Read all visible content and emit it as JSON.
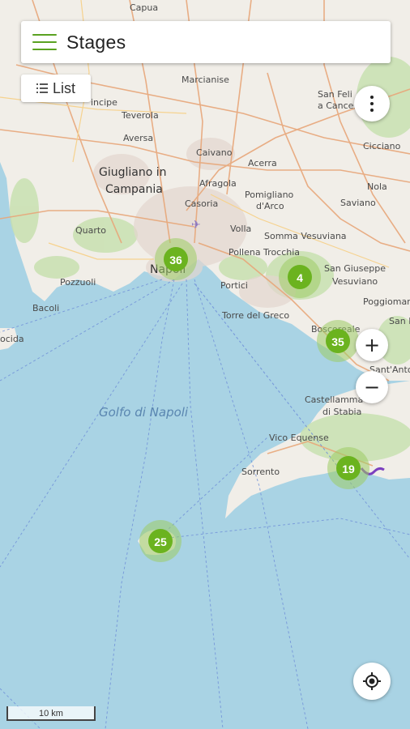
{
  "header": {
    "title": "Stages",
    "menu_icon": "hamburger-menu-icon"
  },
  "list_button": {
    "label": "List",
    "icon": "list-icon"
  },
  "controls": {
    "more_icon": "more-vertical-icon",
    "zoom_in": "+",
    "zoom_out": "−",
    "locate_icon": "my-location-icon"
  },
  "scale": {
    "label": "10 km"
  },
  "colors": {
    "accent": "#6bb31f",
    "sea": "#a9d3e4",
    "land": "#f1eee8",
    "route": "#7b3fbf"
  },
  "places": {
    "capua": "Capua",
    "marcianise": "Marcianise",
    "san_felice": "San Feli",
    "a_cancello": "a Cancel",
    "principe": "incipe",
    "teverola": "Teverola",
    "aversa": "Aversa",
    "cicciano": "Cicciano",
    "caivano": "Caivano",
    "acerra": "Acerra",
    "giugliano": "Giugliano in",
    "campania": "Campania",
    "afragola": "Afragola",
    "nola": "Nola",
    "casoria": "Casoria",
    "pomigliano": "Pomigliano",
    "d_arco": "d'Arco",
    "saviano": "Saviano",
    "quarto": "Quarto",
    "volla": "Volla",
    "somma": "Somma Vesuviana",
    "pollena": "Pollena Trocchia",
    "napoli": "Napoli",
    "san_giuseppe": "San Giuseppe",
    "vesuviano": "Vesuviano",
    "pozzuoli": "Pozzuoli",
    "portici": "Portici",
    "poggiomarino": "Poggiomarin",
    "bacoli": "Bacoli",
    "torre_greco": "Torre del Greco",
    "boscoreale": "Boscoreale",
    "san_m": "San M",
    "procida": "ocida",
    "sant_antonio": "Sant'Anto",
    "castellammare": "Castellamma",
    "di_stabia": "di Stabia",
    "golfo": "Golfo di Napoli",
    "vico": "Vico Equense",
    "sorrento": "Sorrento"
  },
  "clusters": [
    {
      "count": "36"
    },
    {
      "count": "4"
    },
    {
      "count": "35"
    },
    {
      "count": "19"
    },
    {
      "count": "25"
    }
  ]
}
